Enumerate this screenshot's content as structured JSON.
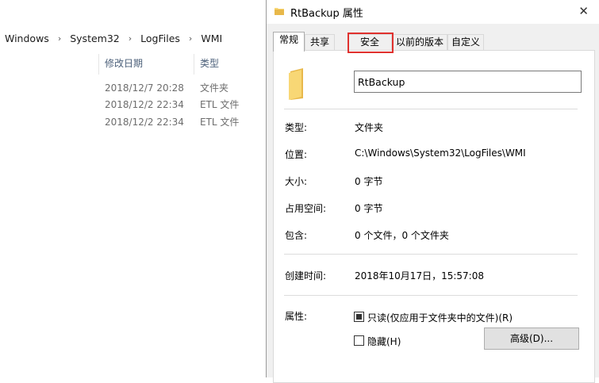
{
  "explorer": {
    "breadcrumb": [
      "Windows",
      "System32",
      "LogFiles",
      "WMI"
    ],
    "columns": {
      "date": "修改日期",
      "type": "类型"
    },
    "rows": [
      {
        "date": "2018/12/7 20:28",
        "type": "文件夹"
      },
      {
        "date": "2018/12/2 22:34",
        "type": "ETL 文件"
      },
      {
        "date": "2018/12/2 22:34",
        "type": "ETL 文件"
      }
    ]
  },
  "dialog": {
    "title": "RtBackup 属性",
    "close_glyph": "✕",
    "tabs": [
      "常规",
      "共享",
      "安全",
      "以前的版本",
      "自定义"
    ],
    "active_tab": "常规",
    "highlighted_tab": "安全",
    "name": "RtBackup",
    "fields": {
      "type_label": "类型:",
      "type_value": "文件夹",
      "location_label": "位置:",
      "location_value": "C:\\Windows\\System32\\LogFiles\\WMI",
      "size_label": "大小:",
      "size_value": "0 字节",
      "disk_label": "占用空间:",
      "disk_value": "0 字节",
      "contains_label": "包含:",
      "contains_value": "0 个文件，0 个文件夹",
      "created_label": "创建时间:",
      "created_value": "2018年10月17日，15:57:08",
      "attributes_label": "属性:"
    },
    "attributes": {
      "readonly_label": "只读(仅应用于文件夹中的文件)(R)",
      "readonly_checked": true,
      "hidden_label": "隐藏(H)",
      "hidden_checked": false,
      "advanced_button": "高级(D)..."
    },
    "colors": {
      "highlight": "#e0312e",
      "folder": "#f8d775"
    }
  }
}
